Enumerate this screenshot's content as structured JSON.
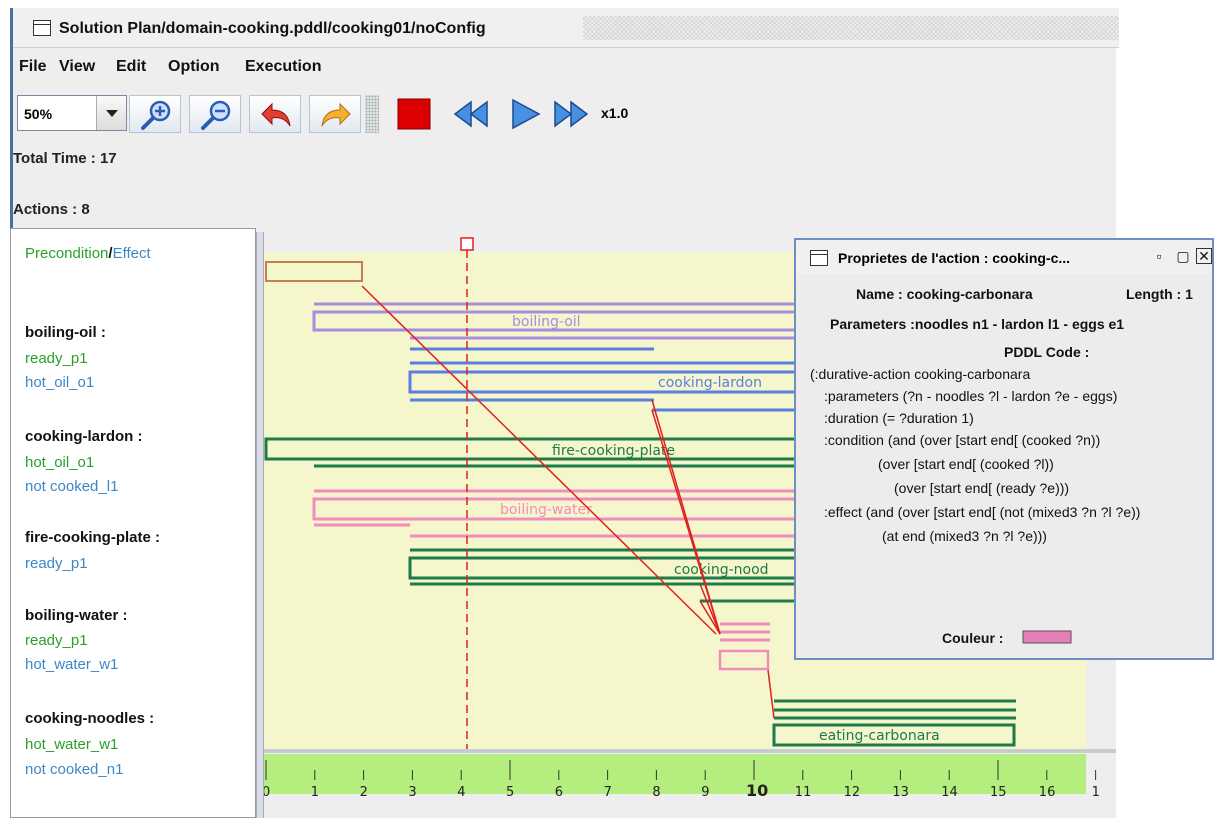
{
  "window": {
    "title": "Solution Plan/domain-cooking.pddl/cooking01/noConfig"
  },
  "menu": [
    "File",
    "View",
    "Edit",
    "Option",
    "Execution"
  ],
  "toolbar": {
    "zoom": "50%",
    "speed": "x1.0",
    "icons": [
      "zoom-in-icon",
      "zoom-out-icon",
      "undo-icon",
      "redo-icon",
      "stop-icon",
      "rewind-icon",
      "play-icon",
      "fast-forward-icon"
    ]
  },
  "info": {
    "total_time": "Total Time : 17",
    "actions": "Actions : 8"
  },
  "legend": {
    "precondition": "Precondition",
    "slash": "/",
    "effect": "Effect"
  },
  "actions_list": [
    {
      "name": "boiling-oil :",
      "precondition": "ready_p1",
      "effect": "hot_oil_o1"
    },
    {
      "name": "cooking-lardon :",
      "precondition": "hot_oil_o1",
      "effect": "not cooked_l1"
    },
    {
      "name": "fire-cooking-plate :",
      "precondition": "",
      "effect": "ready_p1"
    },
    {
      "name": "boiling-water :",
      "precondition": "ready_p1",
      "effect": "hot_water_w1"
    },
    {
      "name": "cooking-noodles :",
      "precondition": "hot_water_w1",
      "effect": "not cooked_n1"
    }
  ],
  "gantt": {
    "bar_labels": [
      "boiling-oil",
      "cooking-lardon",
      "fire-cooking-plate",
      "boiling-water",
      "cooking-nood",
      "eating-carbonara"
    ],
    "timeline_ticks": [
      "0",
      "1",
      "2",
      "3",
      "4",
      "5",
      "6",
      "7",
      "8",
      "9",
      "10",
      "11",
      "12",
      "13",
      "14",
      "15",
      "16",
      "1"
    ],
    "current_time": 4.3
  },
  "properties": {
    "title": "Proprietes de l'action : cooking-c...",
    "name": "Name : cooking-carbonara",
    "length": "Length : 1",
    "parameters": "Parameters :noodles n1 - lardon l1 - eggs e1",
    "pddl_heading": "PDDL Code :",
    "code": [
      "(:durative-action cooking-carbonara",
      ":parameters (?n - noodles ?l - lardon ?e - eggs)",
      ":duration (= ?duration 1)",
      ":condition (and (over [start end[ (cooked ?n))",
      "(over [start end[ (cooked ?l))",
      "(over [start end[ (ready ?e)))",
      ":effect (and (over [start end[ (not (mixed3 ?n ?l ?e))",
      "(at end (mixed3 ?n ?l ?e)))"
    ],
    "color_label": "Couleur :",
    "color": "#e67fb8"
  },
  "colors": {
    "oil": "#a98be0",
    "lardon": "#5b7fe0",
    "plate": "#1d7a4a",
    "water": "#f08cc0",
    "noodles": "#1d7a4a",
    "carbonara": "#1d7a4a",
    "brown": "#c08050",
    "timeline": "#b3ee7f",
    "chart_bg": "#f6f6cc",
    "cursor": "#e02020"
  }
}
